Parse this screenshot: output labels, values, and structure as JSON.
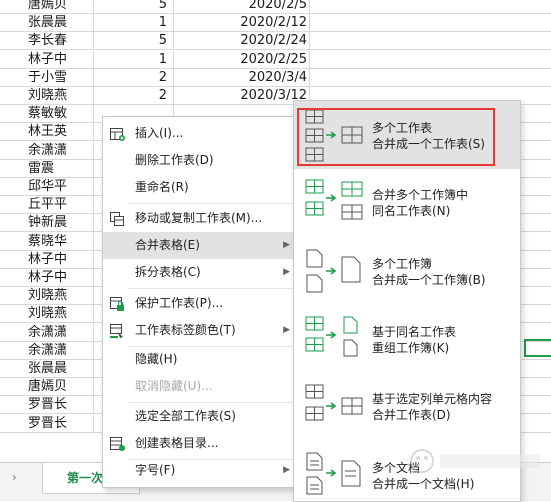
{
  "sheet": {
    "rows": [
      {
        "name": "唐嫣贝",
        "num": "5",
        "date": "2020/2/5"
      },
      {
        "name": "张晨晨",
        "num": "1",
        "date": "2020/2/12"
      },
      {
        "name": "李长春",
        "num": "5",
        "date": "2020/2/24"
      },
      {
        "name": "林子中",
        "num": "1",
        "date": "2020/2/25"
      },
      {
        "name": "于小雪",
        "num": "2",
        "date": "2020/3/4"
      },
      {
        "name": "刘晓燕",
        "num": "2",
        "date": "2020/3/12"
      },
      {
        "name": "蔡敏敏",
        "num": "",
        "date": ""
      },
      {
        "name": "林王英",
        "num": "",
        "date": ""
      },
      {
        "name": "余潇潇",
        "num": "",
        "date": ""
      },
      {
        "name": "雷震",
        "num": "",
        "date": ""
      },
      {
        "name": "邱华平",
        "num": "",
        "date": ""
      },
      {
        "name": "丘平平",
        "num": "",
        "date": ""
      },
      {
        "name": "钟新晨",
        "num": "",
        "date": ""
      },
      {
        "name": "蔡晓华",
        "num": "",
        "date": ""
      },
      {
        "name": "林子中",
        "num": "",
        "date": ""
      },
      {
        "name": "林子中",
        "num": "",
        "date": ""
      },
      {
        "name": "刘晓燕",
        "num": "",
        "date": ""
      },
      {
        "name": "刘晓燕",
        "num": "",
        "date": ""
      },
      {
        "name": "余潇潇",
        "num": "",
        "date": ""
      },
      {
        "name": "余潇潇",
        "num": "",
        "date": ""
      },
      {
        "name": "张晨晨",
        "num": "",
        "date": ""
      },
      {
        "name": "唐嫣贝",
        "num": "",
        "date": ""
      },
      {
        "name": "罗晋长",
        "num": "",
        "date": ""
      },
      {
        "name": "罗晋长",
        "num": "",
        "date": ""
      }
    ]
  },
  "tabs": {
    "nav_label": "›",
    "active_sheet": "第一次考"
  },
  "context_menu": {
    "items": [
      {
        "label": "插入(I)...",
        "icon": "insert-sheet-icon"
      },
      {
        "label": "删除工作表(D)",
        "icon": ""
      },
      {
        "label": "重命名(R)",
        "icon": ""
      },
      {
        "label": "移动或复制工作表(M)...",
        "icon": "move-copy-icon"
      },
      {
        "label": "合并表格(E)",
        "icon": "",
        "arrow": "▶"
      },
      {
        "label": "拆分表格(C)",
        "icon": "",
        "arrow": "▶"
      },
      {
        "label": "保护工作表(P)...",
        "icon": "protect-sheet-icon"
      },
      {
        "label": "工作表标签颜色(T)",
        "icon": "tab-color-icon",
        "arrow": "▶"
      },
      {
        "label": "隐藏(H)",
        "icon": ""
      },
      {
        "label": "取消隐藏(U)...",
        "icon": ""
      },
      {
        "label": "选定全部工作表(S)",
        "icon": ""
      },
      {
        "label": "创建表格目录...",
        "icon": "create-toc-icon"
      },
      {
        "label": "字号(F)",
        "icon": "",
        "arrow": "▶"
      }
    ]
  },
  "submenu": {
    "items": [
      {
        "line1": "多个工作表",
        "line2": "合并成一个工作表(S)",
        "icon": "merge-sheets-icon"
      },
      {
        "line1": "合并多个工作簿中",
        "line2": "同名工作表(N)",
        "icon": "merge-same-name-icon"
      },
      {
        "line1": "多个工作簿",
        "line2": "合并成一个工作簿(B)",
        "icon": "merge-workbooks-icon"
      },
      {
        "line1": "基于同名工作表",
        "line2": "重组工作簿(K)",
        "icon": "regroup-workbook-icon"
      },
      {
        "line1": "基于选定列单元格内容",
        "line2": "合并工作表(D)",
        "icon": "merge-by-column-icon"
      },
      {
        "line1": "多个文档",
        "line2": "合并成一个文档(H)",
        "icon": "merge-documents-icon"
      }
    ]
  },
  "colors": {
    "accent_green": "#1d9e4b",
    "highlight_red": "#e53935",
    "menu_hover": "#e2e2e2"
  }
}
